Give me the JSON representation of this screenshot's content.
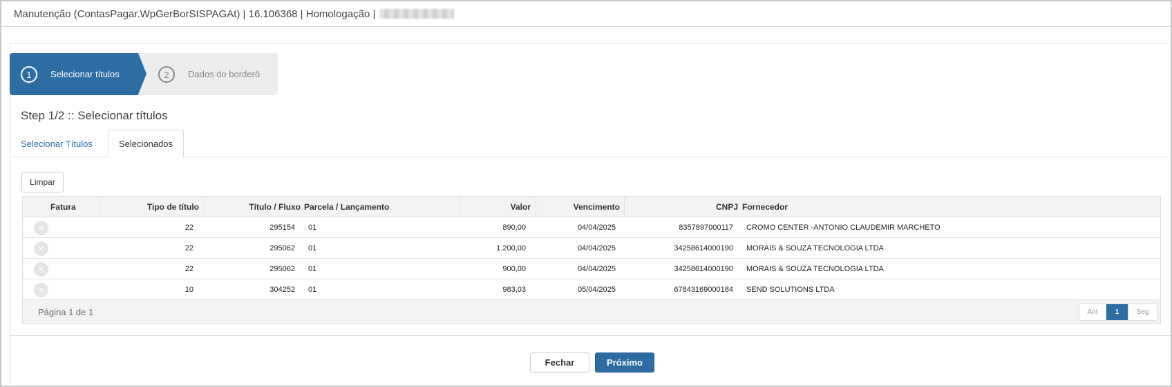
{
  "window": {
    "title": "Manutenção (ContasPagar.WpGerBorSISPAGAt) | 16.106368 | Homologação |"
  },
  "wizard": {
    "steps": [
      {
        "number": "1",
        "label": "Selecionar títulos"
      },
      {
        "number": "2",
        "label": "Dados do borderô"
      }
    ],
    "step_title": "Step 1/2 :: Selecionar títulos"
  },
  "tabs": [
    {
      "label": "Selecionar Títulos"
    },
    {
      "label": "Selecionados"
    }
  ],
  "toolbar": {
    "clear_label": "Limpar"
  },
  "grid": {
    "columns": [
      "Fatura",
      "Tipo de título",
      "Título / Fluxo",
      "Parcela / Lançamento",
      "Valor",
      "Vencimento",
      "CNPJ",
      "Fornecedor"
    ],
    "rows": [
      {
        "tipo": "22",
        "titulo": "295154",
        "parcela": "01",
        "valor": "890,00",
        "vencimento": "04/04/2025",
        "cnpj": "8357897000117",
        "fornecedor": "CROMO CENTER -ANTONIO CLAUDEMIR MARCHETO"
      },
      {
        "tipo": "22",
        "titulo": "295062",
        "parcela": "01",
        "valor": "1.200,00",
        "vencimento": "04/04/2025",
        "cnpj": "34258614000190",
        "fornecedor": "MORAIS & SOUZA TECNOLOGIA LTDA"
      },
      {
        "tipo": "22",
        "titulo": "295062",
        "parcela": "01",
        "valor": "900,00",
        "vencimento": "04/04/2025",
        "cnpj": "34258614000190",
        "fornecedor": "MORAIS & SOUZA TECNOLOGIA LTDA"
      },
      {
        "tipo": "10",
        "titulo": "304252",
        "parcela": "01",
        "valor": "983,03",
        "vencimento": "05/04/2025",
        "cnpj": "67843169000184",
        "fornecedor": "SEND SOLUTIONS LTDA"
      }
    ],
    "remove_icon": "×",
    "page_info": "Página 1 de 1",
    "pager": {
      "prev": "Ant",
      "current": "1",
      "next": "Seg"
    }
  },
  "footer": {
    "close_label": "Fechar",
    "next_label": "Próximo"
  },
  "colors": {
    "primary": "#2e6da4",
    "step_inactive": "#ececec"
  }
}
